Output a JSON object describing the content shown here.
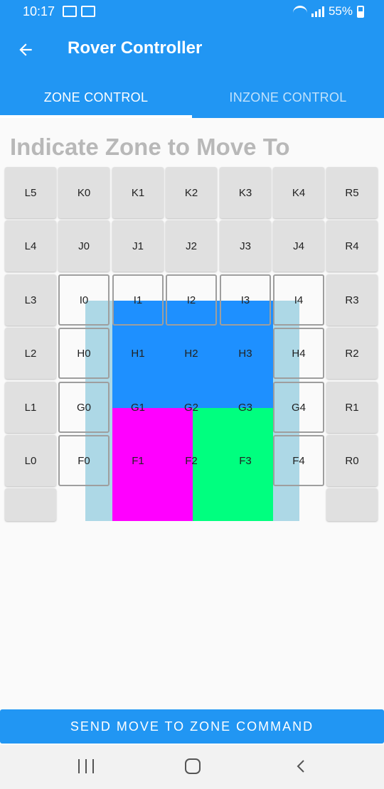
{
  "status_bar": {
    "time": "10:17",
    "battery": "55%",
    "icons": [
      "notification-icon",
      "notification-icon",
      "wifi-icon",
      "signal-icon",
      "battery-icon"
    ]
  },
  "app_bar": {
    "title": "Rover Controller",
    "back_icon": "arrow-left-icon"
  },
  "tabs": [
    {
      "label": "ZONE CONTROL",
      "selected": true
    },
    {
      "label": "INZONE CONTROL",
      "selected": false
    }
  ],
  "heading": "Indicate Zone to Move To",
  "zone_grid": {
    "rows": [
      [
        "L5",
        "K0",
        "K1",
        "K2",
        "K3",
        "K4",
        "R5"
      ],
      [
        "L4",
        "J0",
        "J1",
        "J2",
        "J3",
        "J4",
        "R4"
      ],
      [
        "L3",
        "I0",
        "I1",
        "I2",
        "I3",
        "I4",
        "R3"
      ],
      [
        "L2",
        "H0",
        "H1",
        "H2",
        "H3",
        "H4",
        "R2"
      ],
      [
        "L1",
        "G0",
        "G1",
        "G2",
        "G3",
        "G4",
        "R1"
      ],
      [
        "L0",
        "F0",
        "F1",
        "F2",
        "F3",
        "F4",
        "R0"
      ],
      [
        "",
        "",
        "",
        "",
        "",
        "",
        ""
      ]
    ],
    "colors": {
      "blue": "#1e90ff",
      "light_blue": "#add8e6",
      "magenta": "#ff00ff",
      "green": "#00ff7f",
      "cell": "#e0e0e0"
    }
  },
  "send_button": "SEND MOVE TO ZONE COMMAND",
  "nav_bar": {
    "icons": [
      "recents-icon",
      "home-icon",
      "back-icon"
    ]
  }
}
